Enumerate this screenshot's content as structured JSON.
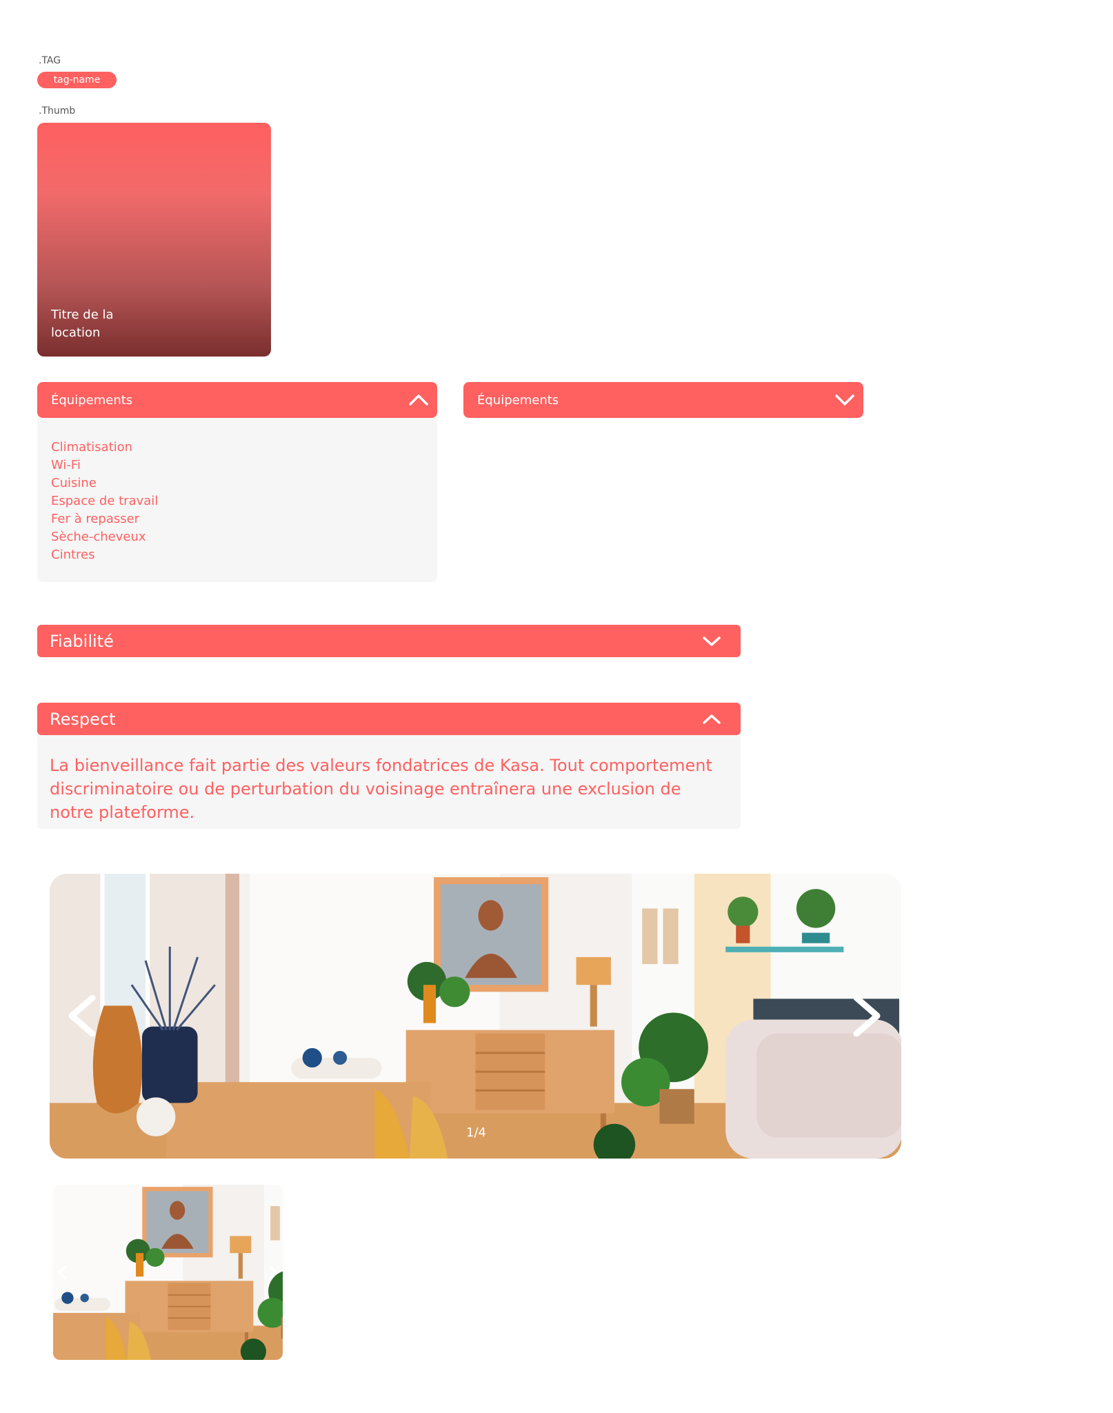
{
  "tag_section": {
    "label": ".TAG",
    "tag": "tag-name"
  },
  "thumb_section": {
    "label": ".Thumb",
    "title": "Titre de la location"
  },
  "collapse_open": {
    "title": "Équipements",
    "items": [
      "Climatisation",
      "Wi-Fi",
      "Cuisine",
      "Espace de travail",
      "Fer à repasser",
      "Sèche-cheveux",
      "Cintres"
    ]
  },
  "collapse_closed": {
    "title": "Équipements"
  },
  "fiabilite": {
    "title": "Fiabilité"
  },
  "respect": {
    "title": "Respect",
    "text": "La bienveillance fait partie des valeurs fondatrices de Kasa. Tout comportement discriminatoire ou de perturbation du voisinage entraînera une exclusion de notre plateforme."
  },
  "carousel": {
    "counter": "1/4"
  },
  "colors": {
    "accent": "#FF6060",
    "panel": "#F6F6F6"
  }
}
